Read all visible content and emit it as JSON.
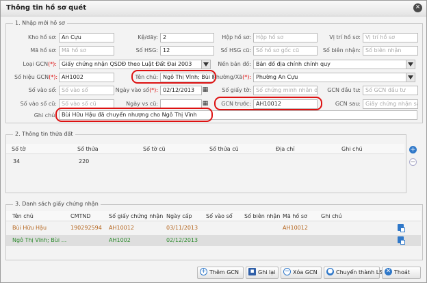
{
  "window": {
    "title": "Thông tin hồ sơ quét"
  },
  "section1": {
    "legend": "1. Nhập mới hồ sơ",
    "fields": {
      "kho_ho_so": {
        "label": "Kho hồ sơ:",
        "value": "An Cựu"
      },
      "ke_day": {
        "label": "Kệ/dãy:",
        "value": "2"
      },
      "hop_ho_so": {
        "label": "Hộp hồ sơ:",
        "placeholder": "Hộp hồ sơ"
      },
      "vi_tri_ho_so": {
        "label": "Vị trí hồ sơ:",
        "placeholder": "Vị trí hồ sơ"
      },
      "ma_ho_so": {
        "label": "Mã hồ sơ:",
        "placeholder": "Mã hồ sơ"
      },
      "so_hsg": {
        "label": "Số HSG:",
        "value": "12"
      },
      "so_hsg_cu": {
        "label": "Số HSG cũ:",
        "placeholder": "Số hồ sơ gốc cũ"
      },
      "so_bien_nhan": {
        "label": "Số biên nhận:",
        "placeholder": "Số biên nhận"
      },
      "loai_gcn": {
        "label": "Loại GCN",
        "value": "Giấy chứng nhận QSDĐ theo Luật Đất Đai 2003"
      },
      "nen_ban_do": {
        "label": "Nền bản đồ:",
        "value": "Bản đồ địa chính chính quy"
      },
      "so_hieu_gcn": {
        "label": "Số hiệu GCN",
        "value": "AH1002"
      },
      "ten_chu": {
        "label": "Tên chủ:",
        "value": "Ngô Thị Vĩnh; Bùi Hữu Hậu"
      },
      "phuong_xa": {
        "label": "Phường/Xã",
        "value": "Phường An Cựu"
      },
      "so_vao_so": {
        "label": "Số vào sổ:",
        "placeholder": "Số vào sổ"
      },
      "ngay_vao_so": {
        "label": "Ngày vào sổ",
        "value": "02/12/2013"
      },
      "so_giay_to": {
        "label": "Số giấy tờ:",
        "placeholder": "Số chứng minh nhân dân"
      },
      "gcn_dau_tu": {
        "label": "GCN đầu tư:",
        "placeholder": "Số GCN đầu tư"
      },
      "so_vao_so_cu": {
        "label": "Số vào sổ cũ:",
        "placeholder": "Số vào sổ cũ"
      },
      "ngay_vs_cu": {
        "label": "Ngày vs cũ:",
        "value": ""
      },
      "gcn_truoc": {
        "label": "GCN trước:",
        "value": "AH10012"
      },
      "gcn_sau": {
        "label": "GCN sau:",
        "placeholder": "Giấy chứng nhận sau"
      },
      "ghi_chu": {
        "label": "Ghi chú:",
        "value": "Bùi Hữu Hậu đã chuyển nhượng cho Ngô Thị Vĩnh"
      }
    },
    "required_mark": "(*):"
  },
  "section2": {
    "legend": "2. Thông tin thửa đất",
    "columns": [
      "Số tờ",
      "Số thửa",
      "Số tờ cũ",
      "Số thửa cũ",
      "Địa chỉ",
      "Ghi chú"
    ],
    "rows": [
      {
        "so_to": "34",
        "so_thua": "220",
        "so_to_cu": "",
        "so_thua_cu": "",
        "dia_chi": "",
        "ghi_chu": ""
      }
    ],
    "add_icon": "+",
    "remove_icon": "−"
  },
  "section3": {
    "legend": "3. Danh sách giấy chứng nhận",
    "columns": [
      "Tên chủ",
      "CMTND",
      "Số giấy chứng nhận",
      "Ngày cấp",
      "Số vào sổ",
      "Số biên nhận",
      "Mã hồ sơ",
      "Ghi chú"
    ],
    "rows": [
      {
        "ten_chu": "Bùi Hữu Hậu",
        "cmtnd": "190292594",
        "so_gcn": "AH10012",
        "ngay_cap": "03/11/2013",
        "so_vao_so": "",
        "so_bien_nhan": "",
        "ma_ho_so": "AH10012",
        "ghi_chu": ""
      },
      {
        "ten_chu": "Ngô Thị Vĩnh; Bùi ...",
        "cmtnd": "",
        "so_gcn": "AH1002",
        "ngay_cap": "02/12/2013",
        "so_vao_so": "",
        "so_bien_nhan": "",
        "ma_ho_so": "",
        "ghi_chu": ""
      }
    ]
  },
  "buttons": {
    "them_gcn": "Thêm GCN",
    "ghi_lai": "Ghi lại",
    "xoa_gcn": "Xóa GCN",
    "chuyen_thanh_ls": "Chuyển thành LS",
    "thoat": "Thoát"
  },
  "colors": {
    "row1_text": "#b5651d",
    "row2_text": "#2e8b2e",
    "accent": "#2f78c9",
    "highlight_red": "#d11111"
  }
}
